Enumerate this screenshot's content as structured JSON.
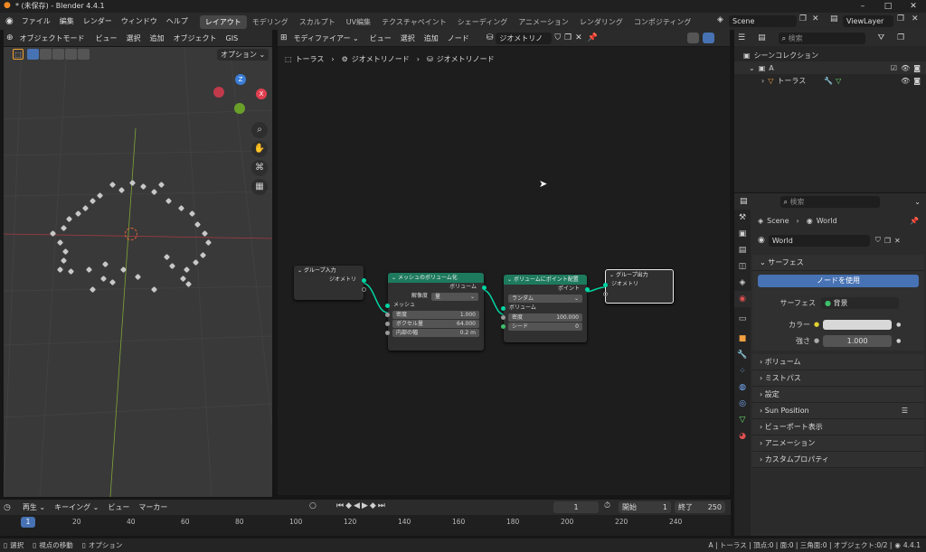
{
  "window": {
    "title": "* (未保存) - Blender 4.4.1"
  },
  "menu": [
    "ファイル",
    "編集",
    "レンダー",
    "ウィンドウ",
    "ヘルプ"
  ],
  "workspaces": [
    "レイアウト",
    "モデリング",
    "スカルプト",
    "UV編集",
    "テクスチャペイント",
    "シェーディング",
    "アニメーション",
    "レンダリング",
    "コンポジティング"
  ],
  "scene": {
    "name": "Scene",
    "viewlayer": "ViewLayer"
  },
  "viewport": {
    "mode": "オブジェクトモード",
    "menus": [
      "ビュー",
      "選択",
      "追加",
      "オブジェクト",
      "GIS"
    ],
    "options": "オプション"
  },
  "nodeeditor": {
    "editor_type": "モディファイアー",
    "menus": [
      "ビュー",
      "選択",
      "追加",
      "ノード"
    ],
    "tree_name": "ジオメトリノード",
    "breadcrumb": [
      "トーラス",
      "ジオメトリノード",
      "ジオメトリノード"
    ],
    "group_input": {
      "title": "グループ入力",
      "out": "ジオメトリ"
    },
    "mesh_to_volume": {
      "title": "メッシュのボリューム化",
      "out": "ボリューム",
      "resolution_label": "解像度",
      "resolution_value": "量",
      "in": "メッシュ",
      "density_label": "密度",
      "density_value": "1.000",
      "voxel_label": "ボクセル量",
      "voxel_value": "64.000",
      "interior_label": "内部の幅",
      "interior_value": "0.2 m"
    },
    "distribute": {
      "title": "ボリュームにポイント配置",
      "out": "ポイント",
      "mode": "ランダム",
      "in": "ボリューム",
      "density_label": "密度",
      "density_value": "100.000",
      "seed_label": "シード",
      "seed_value": "0"
    },
    "group_output": {
      "title": "グループ出力",
      "in": "ジオメトリ"
    }
  },
  "outliner": {
    "search_placeholder": "検索",
    "root": "シーンコレクション",
    "collection": "A",
    "object": "トーラス"
  },
  "properties": {
    "search_placeholder": "検索",
    "breadcrumb": [
      "Scene",
      "World"
    ],
    "world": "World",
    "surface_panel": "サーフェス",
    "use_nodes": "ノードを使用",
    "surface_label": "サーフェス",
    "surface_value": "背景",
    "color_label": "カラー",
    "strength_label": "強さ",
    "strength_value": "1.000",
    "panels": [
      "ボリューム",
      "ミストパス",
      "設定",
      "Sun Position",
      "ビューポート表示",
      "アニメーション",
      "カスタムプロパティ"
    ]
  },
  "timeline": {
    "play": "再生",
    "keying": "キーイング",
    "view": "ビュー",
    "marker": "マーカー",
    "current": "1",
    "start_label": "開始",
    "start": "1",
    "end_label": "終了",
    "end": "250",
    "ticks": [
      "20",
      "40",
      "60",
      "80",
      "100",
      "120",
      "140",
      "160",
      "180",
      "200",
      "220",
      "240"
    ],
    "cursor": "1"
  },
  "status": {
    "select": "選択",
    "move": "視点の移動",
    "options": "オプション",
    "info": "A | トーラス | 頂点:0 | 面:0 | 三角面:0 | オブジェクト:0/2 |",
    "version": "4.4.1"
  },
  "colors": {
    "node_header": "#1e7a5d",
    "socket_geo": "#00d6a3",
    "accent": "#4772b3",
    "active_tab": "#474747"
  }
}
